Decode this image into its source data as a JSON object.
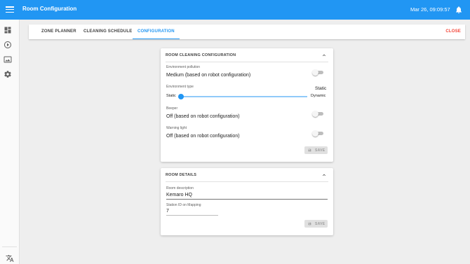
{
  "app": {
    "title": "Room Configuration",
    "datetime": "Mar 26, 09:09:57"
  },
  "sidebar": {
    "items": [
      "dashboard-icon",
      "play-icon",
      "image-icon",
      "settings-icon"
    ],
    "bottom_icon": "translate-icon"
  },
  "tabs": [
    {
      "label": "ZONE PLANNER",
      "active": false
    },
    {
      "label": "CLEANING SCHEDULE",
      "active": false
    },
    {
      "label": "CONFIGURATION",
      "active": true
    }
  ],
  "close_label": "CLOSE",
  "room_cleaning": {
    "title": "ROOM CLEANING CONFIGURATION",
    "environment_pollution": {
      "label": "Environment pollution",
      "value": "Medium (based on robot configuration)",
      "enabled": false
    },
    "environment_type": {
      "label": "Environment type",
      "current": "Static",
      "min_label": "Static",
      "max_label": "Dynamic",
      "position": 0
    },
    "beeper": {
      "label": "Beeper",
      "value": "Off (based on robot configuration)",
      "enabled": false
    },
    "warning_light": {
      "label": "Warning light",
      "value": "Off (based on robot configuration)",
      "enabled": false
    },
    "save_label": "SAVE"
  },
  "room_details": {
    "title": "ROOM DETAILS",
    "room_description": {
      "label": "Room description",
      "value": "Kemaro HQ"
    },
    "station_id": {
      "label": "Station ID on Mapping",
      "value": "7"
    },
    "save_label": "SAVE"
  },
  "colors": {
    "primary": "#2196f3",
    "close": "#f44336",
    "appbar_text": "#ffffff"
  }
}
